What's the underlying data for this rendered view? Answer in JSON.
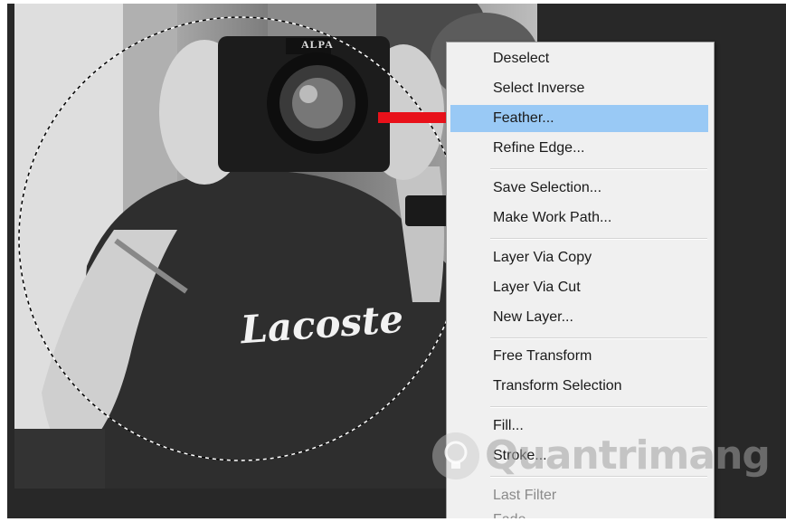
{
  "menu": {
    "items": [
      {
        "label": "Deselect",
        "state": "normal"
      },
      {
        "label": "Select Inverse",
        "state": "normal"
      },
      {
        "label": "Feather...",
        "state": "highlighted"
      },
      {
        "label": "Refine Edge...",
        "state": "normal"
      },
      {
        "label": "Save Selection...",
        "state": "normal"
      },
      {
        "label": "Make Work Path...",
        "state": "normal"
      },
      {
        "label": "Layer Via Copy",
        "state": "normal"
      },
      {
        "label": "Layer Via Cut",
        "state": "normal"
      },
      {
        "label": "New Layer...",
        "state": "normal"
      },
      {
        "label": "Free Transform",
        "state": "normal"
      },
      {
        "label": "Transform Selection",
        "state": "normal"
      },
      {
        "label": "Fill...",
        "state": "normal"
      },
      {
        "label": "Stroke...",
        "state": "normal"
      },
      {
        "label": "Last Filter",
        "state": "disabled"
      },
      {
        "label": "Fade...",
        "state": "disabled"
      }
    ]
  },
  "photo": {
    "camera_brand": "ALPA",
    "shirt_logo": "Lacoste"
  },
  "watermark": {
    "text": "Quantrimang",
    "icon": "lightbulb-icon"
  },
  "colors": {
    "highlight": "#99c9f5",
    "arrow": "#e8111a",
    "workspace": "#282828",
    "menu_bg": "#f0f0f0"
  }
}
